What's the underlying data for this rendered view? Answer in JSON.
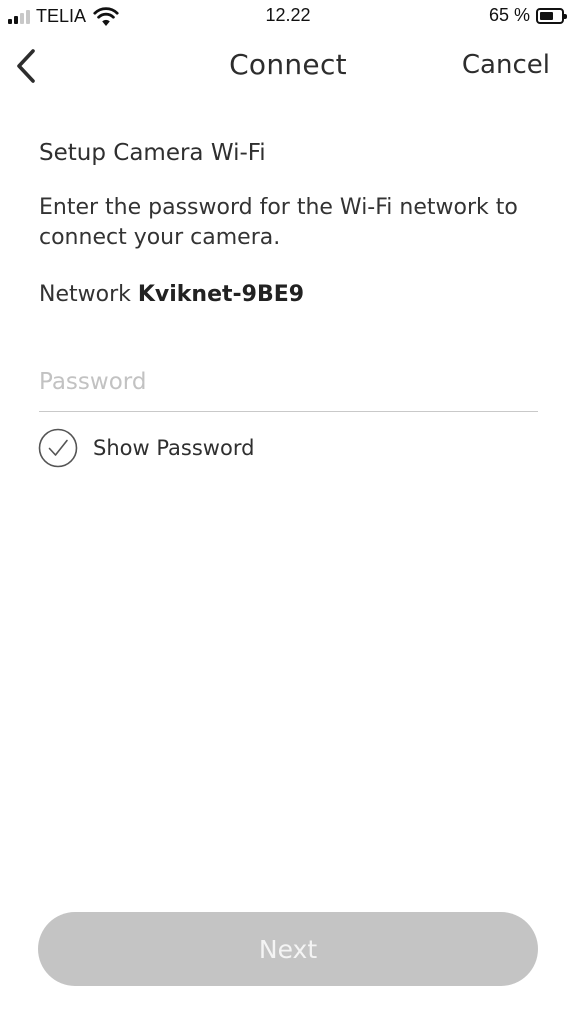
{
  "status_bar": {
    "carrier": "TELIA",
    "time": "12.22",
    "battery_percent": "65 %",
    "battery_level": 0.65,
    "signal_bars": 2,
    "signal_icon": "cellular-signal-icon",
    "wifi_icon": "wifi-icon",
    "battery_icon": "battery-icon"
  },
  "nav": {
    "back_icon": "chevron-left-icon",
    "title": "Connect",
    "cancel_label": "Cancel"
  },
  "content": {
    "section_title": "Setup Camera Wi-Fi",
    "instructions": "Enter the password for the Wi-Fi network to connect your camera.",
    "network_label": "Network",
    "network_name": "Kviknet-9BE9",
    "password_placeholder": "Password",
    "password_value": "",
    "show_password_label": "Show Password",
    "show_password_icon": "checkmark-circle-icon"
  },
  "footer": {
    "next_label": "Next",
    "next_enabled": false
  },
  "colors": {
    "text": "#2d2d2d",
    "disabled_button": "#c4c4c4",
    "disabled_button_text": "#f4f4f4",
    "placeholder": "#c2c2c2",
    "divider": "#c9c9c9"
  }
}
